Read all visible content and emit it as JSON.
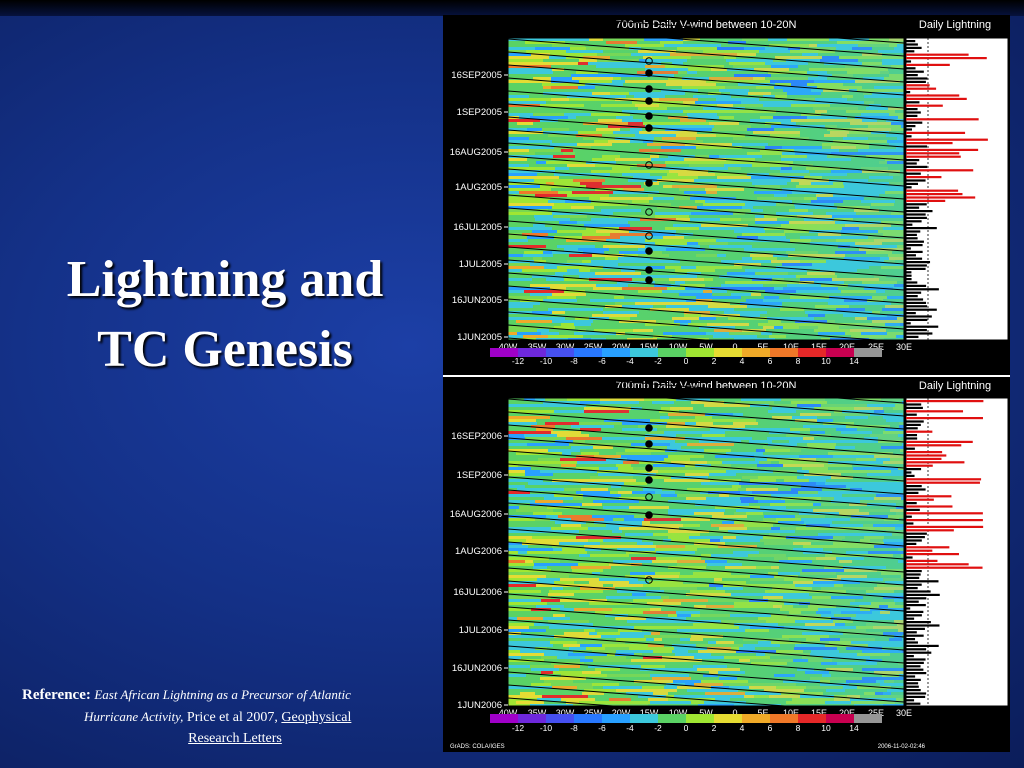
{
  "slide": {
    "title_line1": "Lightning and",
    "title_line2": "TC Genesis",
    "reference": {
      "label": "Reference:",
      "italic_part1": "East African Lightning as a Precursor  of  Atlantic",
      "italic_part2": "Hurricane Activity,",
      "plain_part": " Price et al 2007, ",
      "link_part1": "Geophysical",
      "link_part2": "Research Letters"
    }
  },
  "chart_data": [
    {
      "type": "heatmap",
      "title": "700mb Daily V-wind between 10-20N",
      "side_title": "Daily Lightning",
      "x_ticks": [
        "40W",
        "35W",
        "30W",
        "25W",
        "20W",
        "15W",
        "10W",
        "5W",
        "0",
        "5E",
        "10E",
        "15E",
        "20E",
        "25E",
        "30E"
      ],
      "y_ticks": [
        "16SEP2005",
        "1SEP2005",
        "16AUG2005",
        "1AUG2005",
        "16JUL2005",
        "1JUL2005",
        "16JUN2005",
        "1JUN2005"
      ],
      "colorbar_ticks": [
        "-12",
        "-10",
        "-8",
        "-6",
        "-4",
        "-2",
        "0",
        "2",
        "4",
        "6",
        "8",
        "10",
        "14"
      ],
      "colorbar_colors": [
        "#a000c8",
        "#6e28dc",
        "#4650f0",
        "#2878ff",
        "#28a0ff",
        "#3cc8dc",
        "#5ad264",
        "#a0e632",
        "#e6dc32",
        "#f0aa28",
        "#f07828",
        "#e62828",
        "#c80050",
        "#969696"
      ],
      "genesis_markers_open": [
        61,
        165,
        212,
        236
      ],
      "genesis_markers_filled": [
        73,
        89,
        101,
        116,
        128,
        183,
        251,
        270,
        280
      ]
    },
    {
      "type": "heatmap",
      "title": "700mb Daily V-wind between 10-20N",
      "side_title": "Daily Lightning",
      "x_ticks": [
        "40W",
        "35W",
        "30W",
        "25W",
        "20W",
        "15W",
        "10W",
        "5W",
        "0",
        "5E",
        "10E",
        "15E",
        "20E",
        "25E",
        "30E"
      ],
      "y_ticks": [
        "16SEP2006",
        "1SEP2006",
        "16AUG2006",
        "1AUG2006",
        "16JUL2006",
        "1JUL2006",
        "16JUN2006",
        "1JUN2006"
      ],
      "colorbar_ticks": [
        "-12",
        "-10",
        "-8",
        "-6",
        "-4",
        "-2",
        "0",
        "2",
        "4",
        "6",
        "8",
        "10",
        "14"
      ],
      "colorbar_colors": [
        "#a000c8",
        "#6e28dc",
        "#4650f0",
        "#2878ff",
        "#28a0ff",
        "#3cc8dc",
        "#5ad264",
        "#a0e632",
        "#e6dc32",
        "#f0aa28",
        "#f07828",
        "#e62828",
        "#c80050",
        "#969696"
      ],
      "footer_left": "GrADS: COLA/IGES",
      "footer_right": "2006-11-02-02:46",
      "genesis_markers_open": [
        497,
        580
      ],
      "genesis_markers_filled": [
        428,
        444,
        468,
        480,
        515
      ]
    }
  ]
}
